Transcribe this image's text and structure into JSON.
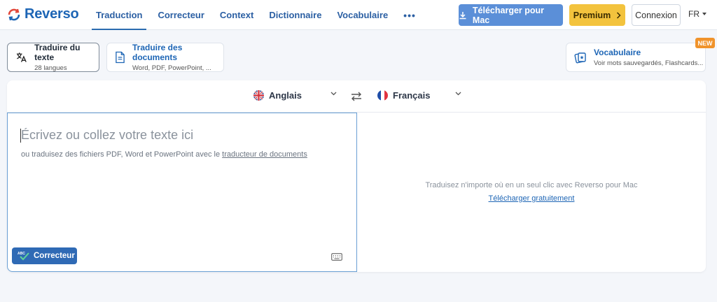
{
  "brand": {
    "name": "Reverso"
  },
  "nav": {
    "items": [
      {
        "label": "Traduction"
      },
      {
        "label": "Correcteur"
      },
      {
        "label": "Context"
      },
      {
        "label": "Dictionnaire"
      },
      {
        "label": "Vocabulaire"
      }
    ],
    "more": "•••"
  },
  "header": {
    "download_mac": "Télécharger pour Mac",
    "premium": "Premium",
    "login": "Connexion",
    "ui_language": "FR"
  },
  "modes": [
    {
      "title": "Traduire du texte",
      "subtitle": "28 langues"
    },
    {
      "title": "Traduire des documents",
      "subtitle": "Word, PDF, PowerPoint, ..."
    },
    {
      "title": "Vocabulaire",
      "subtitle": "Voir mots sauvegardés, Flashcards..."
    }
  ],
  "new_badge": "NEW",
  "translator": {
    "source_language": "Anglais",
    "target_language": "Français",
    "placeholder": "Écrivez ou collez votre texte ici",
    "hint_prefix": "ou traduisez des fichiers PDF, Word et PowerPoint avec le",
    "hint_link": "traducteur de documents",
    "corrector_button": "Correcteur",
    "corrector_icon_text": "ABC",
    "promo_text": "Traduisez n'importe où en un seul clic avec Reverso pour Mac",
    "promo_link": "Télécharger gratuitement"
  },
  "colors": {
    "brand_blue": "#1d65b5",
    "mac_button": "#5b8fd8",
    "premium": "#f3c33d",
    "new_badge": "#f0932b",
    "corrector_button": "#2f6ab5"
  },
  "icons": [
    "reverso-logo-icon",
    "download-icon",
    "chevron-right-icon",
    "caret-down-icon",
    "translate-icon",
    "document-icon",
    "flashcards-icon",
    "uk-flag-icon",
    "fr-flag-icon",
    "swap-icon",
    "keyboard-icon",
    "check-icon"
  ]
}
